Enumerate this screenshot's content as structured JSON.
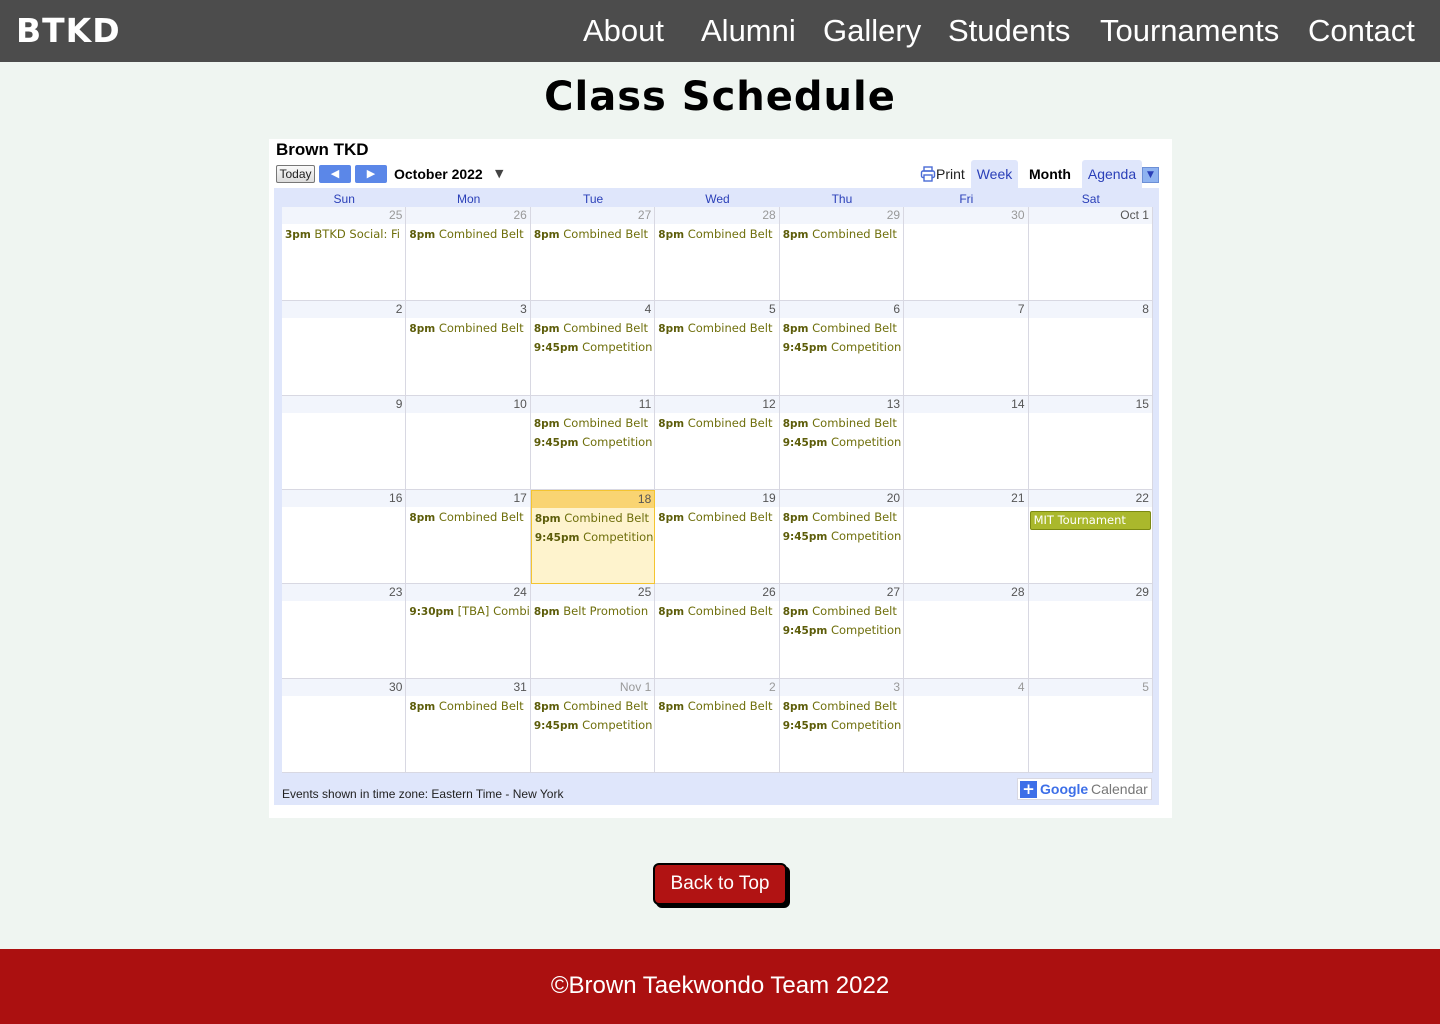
{
  "nav": {
    "logo": "BTKD",
    "links": [
      "About",
      "Alumni",
      "Gallery",
      "Students",
      "Tournaments",
      "Contact"
    ]
  },
  "page_title": "Class Schedule",
  "calendar": {
    "title": "Brown TKD",
    "today_label": "Today",
    "prev_icon": "◀",
    "next_icon": "▶",
    "month_label": "October 2022",
    "month_caret": "▼",
    "print_label": "Print",
    "tabs": [
      "Week",
      "Month",
      "Agenda"
    ],
    "active_tab": "Month",
    "agenda_caret": "▼",
    "days_of_week": [
      "Sun",
      "Mon",
      "Tue",
      "Wed",
      "Thu",
      "Fri",
      "Sat"
    ],
    "weeks": [
      [
        {
          "day": "25",
          "other": true,
          "events": [
            {
              "time": "3pm",
              "title": "BTKD Social: Fi"
            }
          ]
        },
        {
          "day": "26",
          "other": true,
          "events": [
            {
              "time": "8pm",
              "title": "Combined Belt"
            }
          ]
        },
        {
          "day": "27",
          "other": true,
          "events": [
            {
              "time": "8pm",
              "title": "Combined Belt"
            }
          ]
        },
        {
          "day": "28",
          "other": true,
          "events": [
            {
              "time": "8pm",
              "title": "Combined Belt"
            }
          ]
        },
        {
          "day": "29",
          "other": true,
          "events": [
            {
              "time": "8pm",
              "title": "Combined Belt"
            }
          ]
        },
        {
          "day": "30",
          "other": true,
          "events": []
        },
        {
          "day": "Oct 1",
          "other": false,
          "events": []
        }
      ],
      [
        {
          "day": "2",
          "events": []
        },
        {
          "day": "3",
          "events": [
            {
              "time": "8pm",
              "title": "Combined Belt"
            }
          ]
        },
        {
          "day": "4",
          "events": [
            {
              "time": "8pm",
              "title": "Combined Belt"
            },
            {
              "time": "9:45pm",
              "title": "Competition"
            }
          ]
        },
        {
          "day": "5",
          "events": [
            {
              "time": "8pm",
              "title": "Combined Belt"
            }
          ]
        },
        {
          "day": "6",
          "events": [
            {
              "time": "8pm",
              "title": "Combined Belt"
            },
            {
              "time": "9:45pm",
              "title": "Competition"
            }
          ]
        },
        {
          "day": "7",
          "events": []
        },
        {
          "day": "8",
          "events": []
        }
      ],
      [
        {
          "day": "9",
          "events": []
        },
        {
          "day": "10",
          "events": []
        },
        {
          "day": "11",
          "events": [
            {
              "time": "8pm",
              "title": "Combined Belt"
            },
            {
              "time": "9:45pm",
              "title": "Competition"
            }
          ]
        },
        {
          "day": "12",
          "events": [
            {
              "time": "8pm",
              "title": "Combined Belt"
            }
          ]
        },
        {
          "day": "13",
          "events": [
            {
              "time": "8pm",
              "title": "Combined Belt"
            },
            {
              "time": "9:45pm",
              "title": "Competition"
            }
          ]
        },
        {
          "day": "14",
          "events": []
        },
        {
          "day": "15",
          "events": []
        }
      ],
      [
        {
          "day": "16",
          "events": []
        },
        {
          "day": "17",
          "events": [
            {
              "time": "8pm",
              "title": "Combined Belt"
            }
          ]
        },
        {
          "day": "18",
          "today": true,
          "events": [
            {
              "time": "8pm",
              "title": "Combined Belt"
            },
            {
              "time": "9:45pm",
              "title": "Competition"
            }
          ]
        },
        {
          "day": "19",
          "events": [
            {
              "time": "8pm",
              "title": "Combined Belt"
            }
          ]
        },
        {
          "day": "20",
          "events": [
            {
              "time": "8pm",
              "title": "Combined Belt"
            },
            {
              "time": "9:45pm",
              "title": "Competition"
            }
          ]
        },
        {
          "day": "21",
          "events": []
        },
        {
          "day": "22",
          "events": [],
          "block": "MIT Tournament"
        }
      ],
      [
        {
          "day": "23",
          "events": []
        },
        {
          "day": "24",
          "events": [
            {
              "time": "9:30pm",
              "title": "[TBA] Combi"
            }
          ]
        },
        {
          "day": "25",
          "events": [
            {
              "time": "8pm",
              "title": "Belt Promotion"
            }
          ]
        },
        {
          "day": "26",
          "events": [
            {
              "time": "8pm",
              "title": "Combined Belt"
            }
          ]
        },
        {
          "day": "27",
          "events": [
            {
              "time": "8pm",
              "title": "Combined Belt"
            },
            {
              "time": "9:45pm",
              "title": "Competition"
            }
          ]
        },
        {
          "day": "28",
          "events": []
        },
        {
          "day": "29",
          "events": []
        }
      ],
      [
        {
          "day": "30",
          "events": []
        },
        {
          "day": "31",
          "events": [
            {
              "time": "8pm",
              "title": "Combined Belt"
            }
          ]
        },
        {
          "day": "Nov 1",
          "other": true,
          "events": [
            {
              "time": "8pm",
              "title": "Combined Belt"
            },
            {
              "time": "9:45pm",
              "title": "Competition"
            }
          ]
        },
        {
          "day": "2",
          "other": true,
          "events": [
            {
              "time": "8pm",
              "title": "Combined Belt"
            }
          ]
        },
        {
          "day": "3",
          "other": true,
          "events": [
            {
              "time": "8pm",
              "title": "Combined Belt"
            },
            {
              "time": "9:45pm",
              "title": "Competition"
            }
          ]
        },
        {
          "day": "4",
          "other": true,
          "events": []
        },
        {
          "day": "5",
          "other": true,
          "events": []
        }
      ]
    ],
    "timezone_note": "Events shown in time zone: Eastern Time - New York",
    "badge": {
      "plus": "+",
      "google": "Google",
      "calendar": "Calendar"
    }
  },
  "back_to_top": "Back to Top",
  "footer": "©Brown Taekwondo Team 2022",
  "colors": {
    "navbar": "#4c4c4c",
    "page_bg": "#eff5f1",
    "accent_red": "#ab1010",
    "event_text": "#6f6f0c",
    "event_block": "#aab82c",
    "today_cell": "#fef3cd"
  }
}
